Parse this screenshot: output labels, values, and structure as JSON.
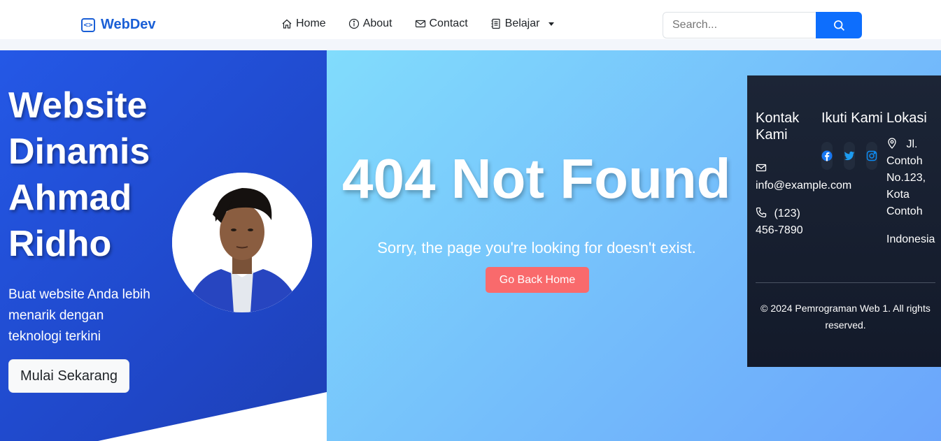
{
  "navbar": {
    "brand": "WebDev",
    "items": [
      {
        "label": "Home",
        "icon": "home-icon"
      },
      {
        "label": "About",
        "icon": "info-icon"
      },
      {
        "label": "Contact",
        "icon": "envelope-icon"
      },
      {
        "label": "Belajar",
        "icon": "journal-icon"
      }
    ],
    "search_placeholder": "Search..."
  },
  "hero": {
    "title": "Website Dinamis Ahmad Ridho",
    "subtitle": "Buat website Anda lebih menarik dengan teknologi terkini",
    "button": "Mulai Sekarang"
  },
  "error": {
    "title": "404 Not Found",
    "message": "Sorry, the page you're looking for doesn't exist.",
    "button": "Go Back Home"
  },
  "footer": {
    "contact_heading": "Kontak Kami",
    "email": "info@example.com",
    "phone": "(123) 456-7890",
    "follow_heading": "Ikuti Kami",
    "location_heading": "Lokasi",
    "address": "Jl. Contoh No.123, Kota Contoh",
    "country": "Indonesia",
    "copyright": "© 2024 Pemrograman Web 1. All rights reserved."
  },
  "colors": {
    "brand": "#1a5fd6",
    "search_button": "#0d6efd",
    "error_button": "#f96a6c",
    "hero_bg": "#2458e6",
    "footer_bg": "#1c2536"
  }
}
